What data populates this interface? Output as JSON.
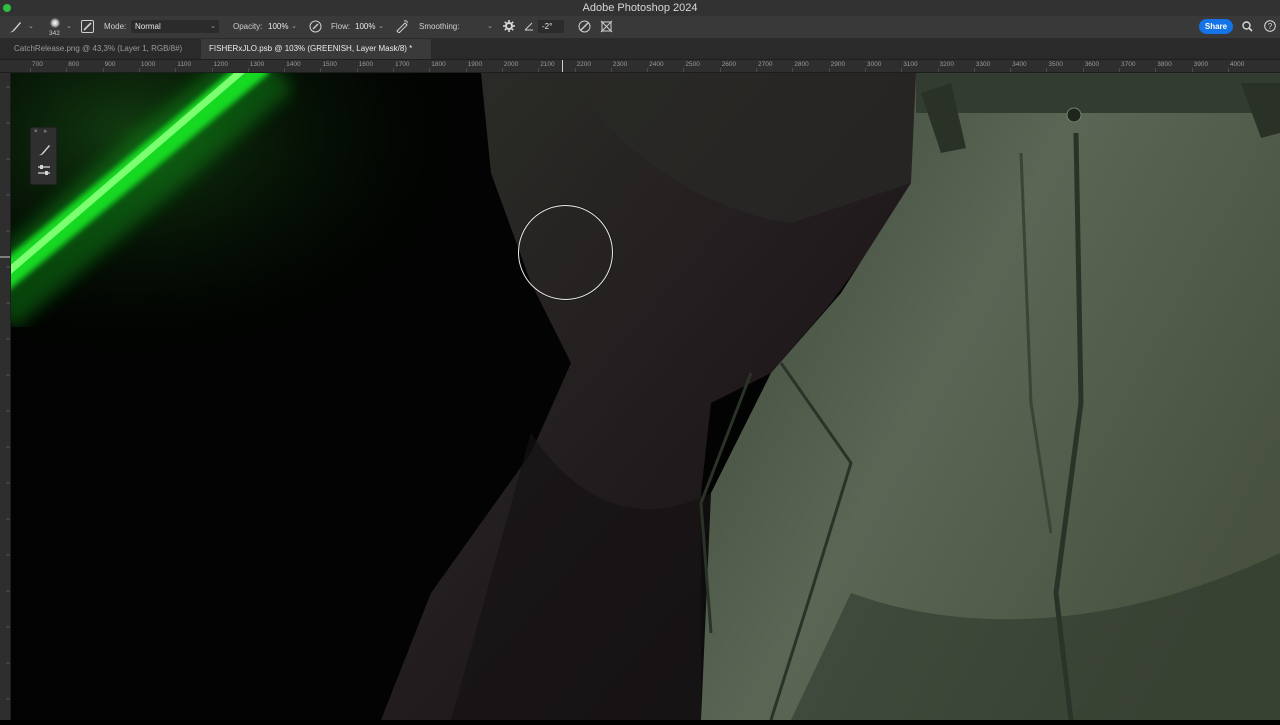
{
  "window": {
    "title": "Adobe Photoshop 2024",
    "traffic_light_color": "#2fbf3f"
  },
  "options_bar": {
    "brush_size": "342",
    "mode_label": "Mode:",
    "mode_value": "Normal",
    "opacity_label": "Opacity:",
    "opacity_value": "100%",
    "flow_label": "Flow:",
    "flow_value": "100%",
    "smoothing_label": "Smoothing:",
    "smoothing_value": "",
    "angle_value": "-2°",
    "share_label": "Share",
    "accent_color": "#1473e6"
  },
  "tabs": [
    {
      "label": "CatchRelease.png @ 43,3% (Layer 1, RGB/8#)",
      "active": false
    },
    {
      "label": "FISHERxJLO.psb @ 103% (GREENISH, Layer Mask/8) *",
      "active": true
    }
  ],
  "ruler": {
    "ticks": [
      "700",
      "800",
      "900",
      "1000",
      "1100",
      "1200",
      "1300",
      "1400",
      "1500",
      "1600",
      "1700",
      "1800",
      "1900",
      "2000",
      "2100",
      "2200",
      "2300",
      "2400",
      "2500",
      "2600",
      "2700",
      "2800",
      "2900",
      "3000",
      "3100",
      "3200",
      "3300",
      "3400",
      "3500",
      "3600",
      "3700",
      "3800",
      "3900",
      "4000"
    ]
  },
  "panel": {
    "icons": [
      "brush-tool-icon",
      "brush-settings-icon"
    ]
  }
}
